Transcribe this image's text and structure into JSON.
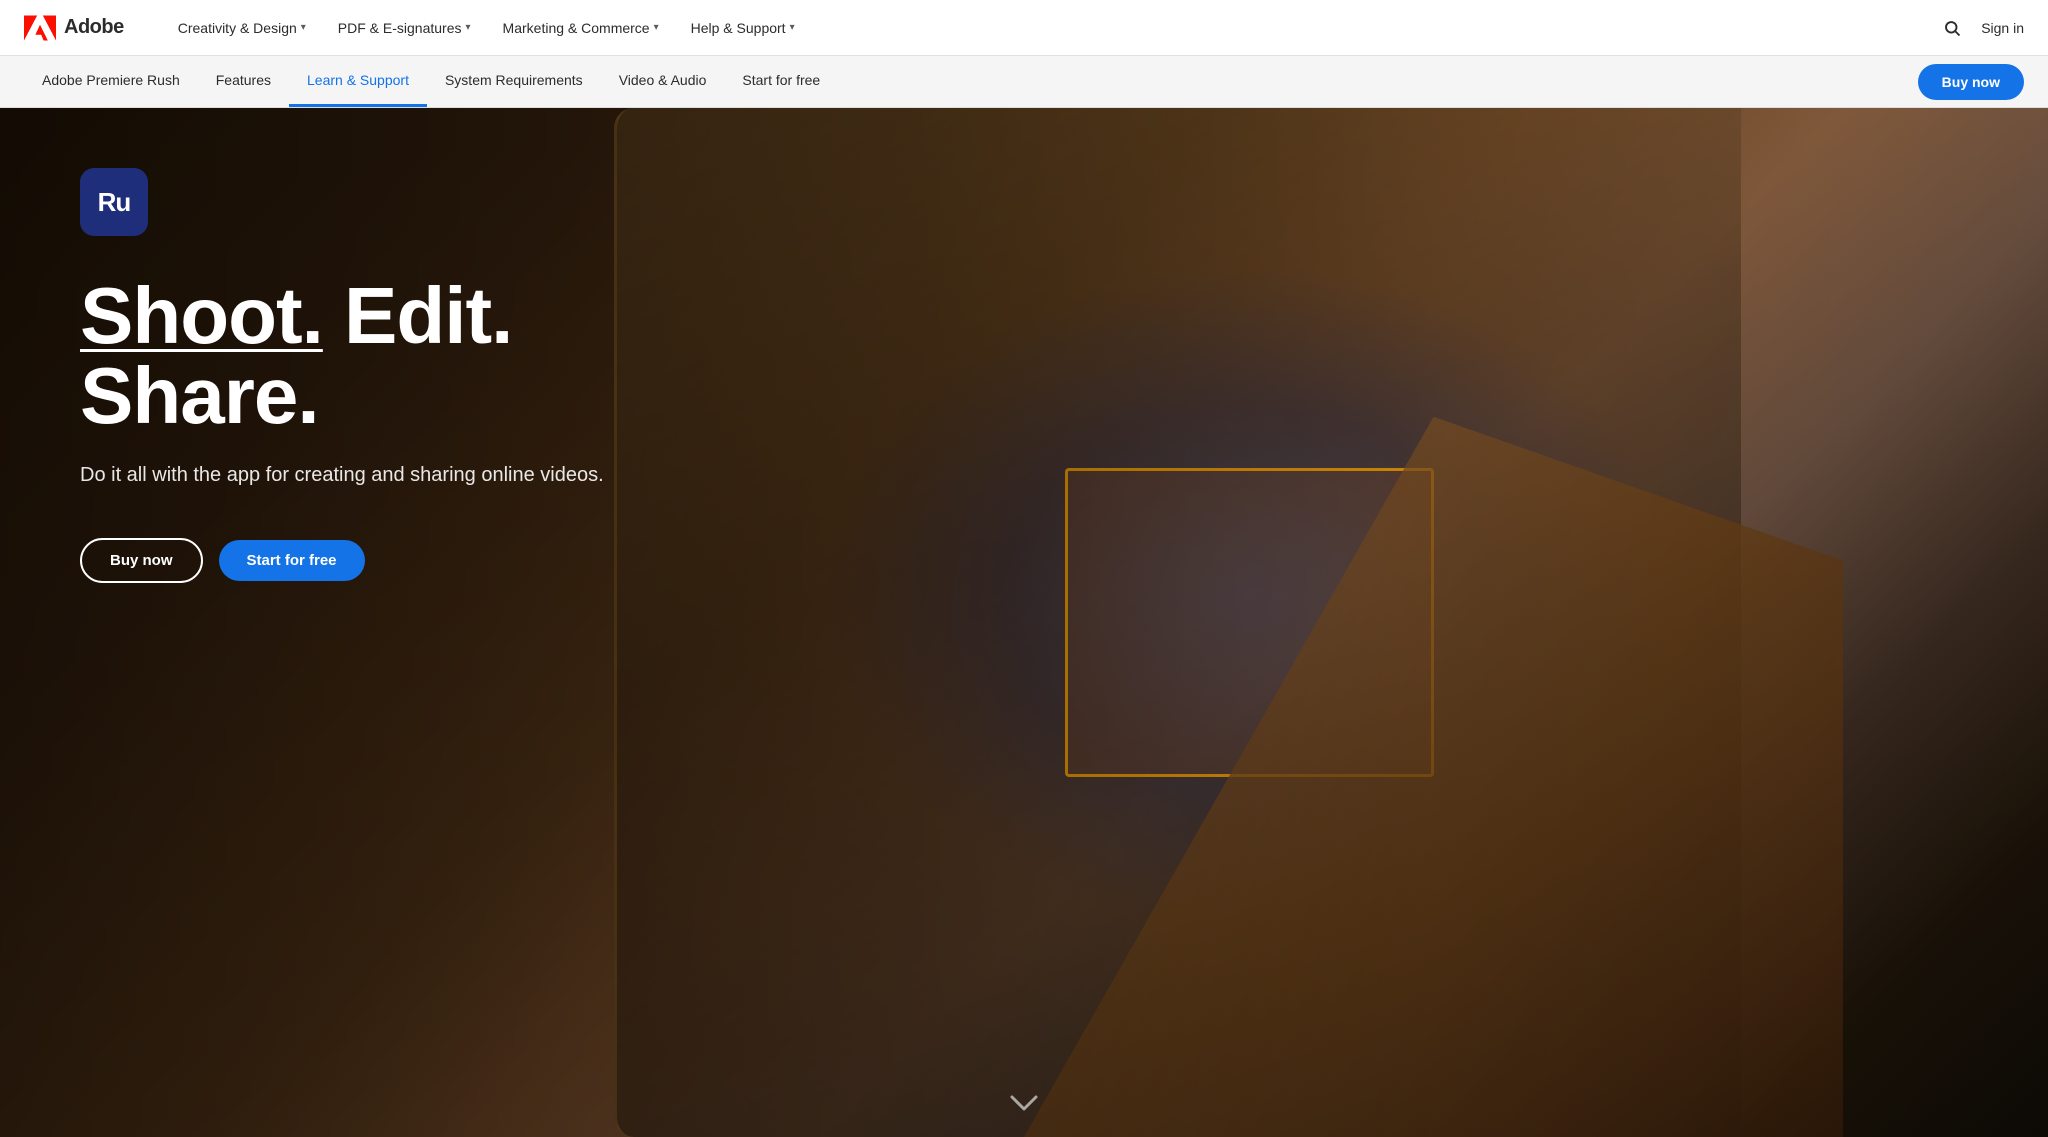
{
  "topNav": {
    "logo": {
      "icon_label": "Adobe logo",
      "text": "Adobe"
    },
    "links": [
      {
        "label": "Creativity & Design",
        "has_chevron": true
      },
      {
        "label": "PDF & E-signatures",
        "has_chevron": true
      },
      {
        "label": "Marketing & Commerce",
        "has_chevron": true
      },
      {
        "label": "Help & Support",
        "has_chevron": true
      }
    ],
    "search_label": "Search",
    "signin_label": "Sign in"
  },
  "subNav": {
    "links": [
      {
        "label": "Adobe Premiere Rush",
        "active": false
      },
      {
        "label": "Features",
        "active": false
      },
      {
        "label": "Learn & Support",
        "active": true
      },
      {
        "label": "System Requirements",
        "active": false
      },
      {
        "label": "Video & Audio",
        "active": false
      },
      {
        "label": "Start for free",
        "active": false
      }
    ],
    "buy_now_label": "Buy now"
  },
  "hero": {
    "product_icon": "Ru",
    "title_underline": "Shoot.",
    "title_rest": " Edit. Share.",
    "subtitle": "Do it all with the app for creating and sharing online videos.",
    "buy_now_label": "Buy now",
    "start_free_label": "Start for free",
    "scroll_icon": "❯"
  }
}
